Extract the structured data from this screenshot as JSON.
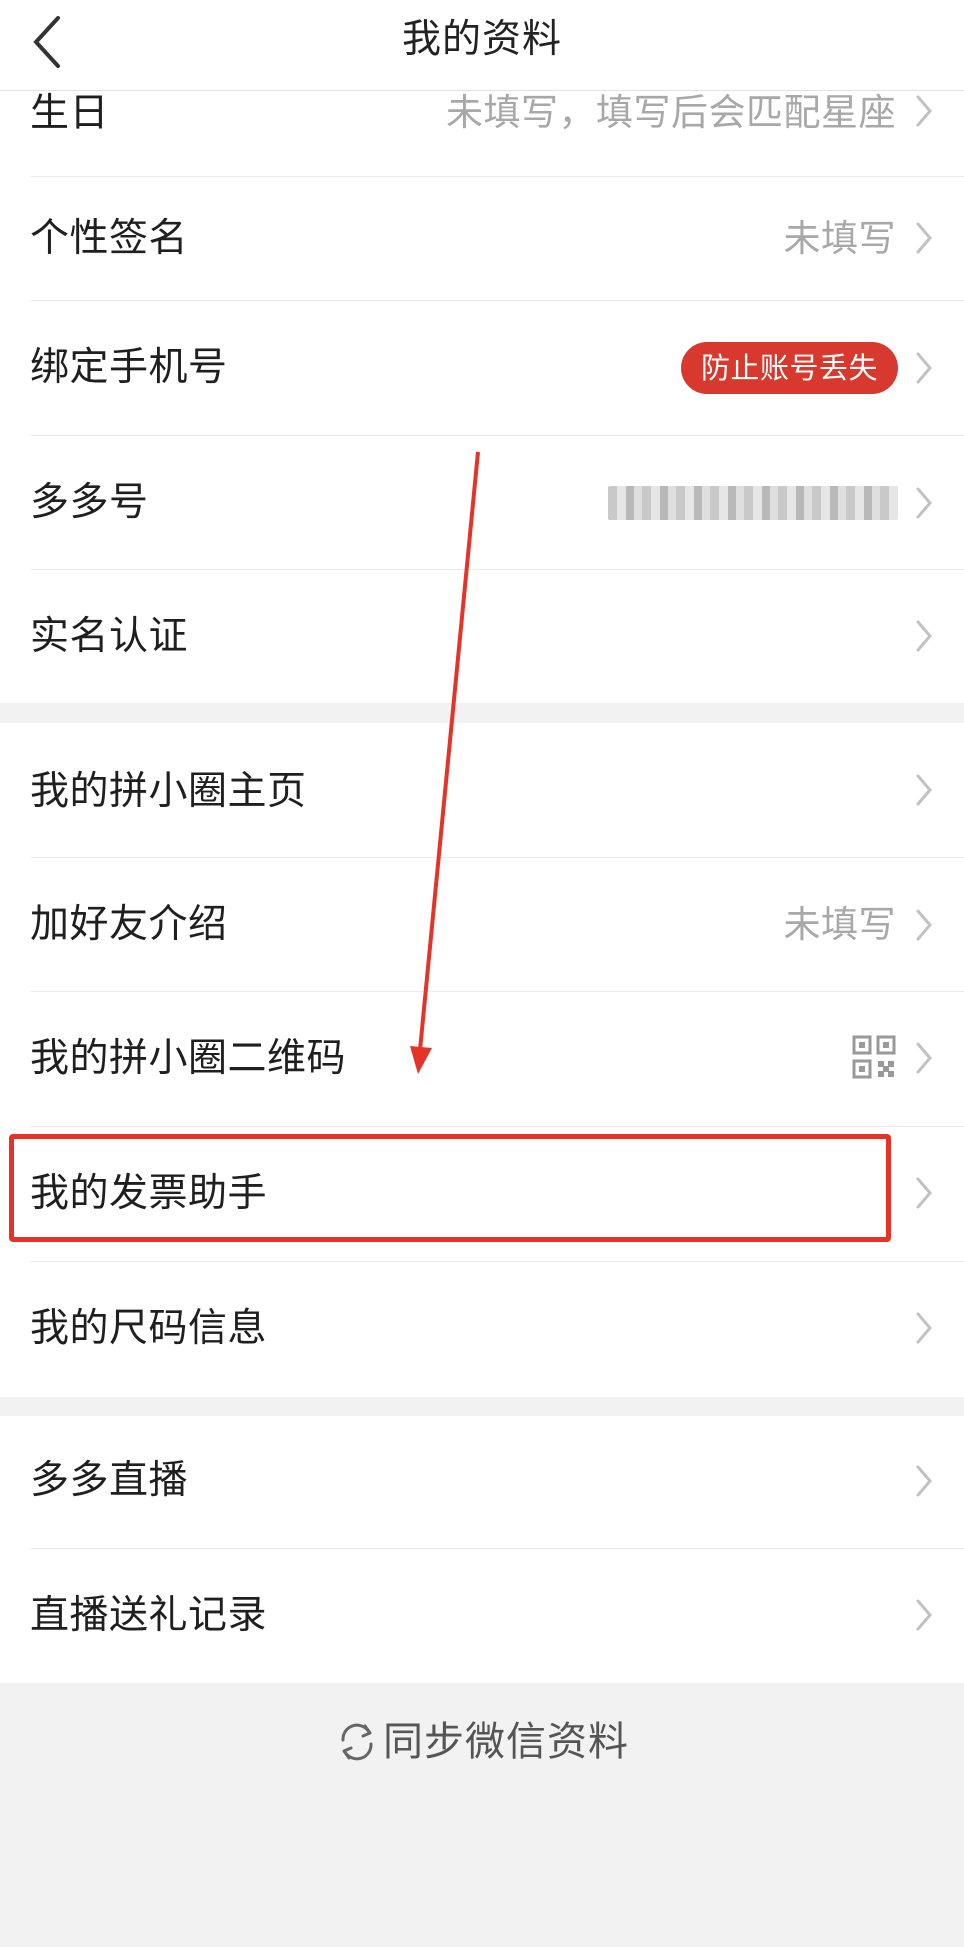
{
  "header": {
    "title": "我的资料"
  },
  "group1": {
    "rows": [
      {
        "label": "生日",
        "value": "未填写，填写后会匹配星座"
      },
      {
        "label": "个性签名",
        "value": "未填写"
      },
      {
        "label": "绑定手机号",
        "badge": "防止账号丢失"
      },
      {
        "label": "多多号",
        "value_obscured": true
      },
      {
        "label": "实名认证"
      }
    ]
  },
  "group2": {
    "rows": [
      {
        "label": "我的拼小圈主页"
      },
      {
        "label": "加好友介绍",
        "value": "未填写"
      },
      {
        "label": "我的拼小圈二维码",
        "icon": "qr-code-icon"
      },
      {
        "label": "我的发票助手",
        "highlighted": true
      },
      {
        "label": "我的尺码信息"
      }
    ]
  },
  "group3": {
    "rows": [
      {
        "label": "多多直播"
      },
      {
        "label": "直播送礼记录"
      }
    ]
  },
  "footer": {
    "sync_label": "同步微信资料",
    "sync_icon": "refresh-icon"
  },
  "colors": {
    "accent_red": "#d8392e",
    "annotation_red": "#e53327",
    "muted_text": "#a8a8a8",
    "background": "#f2f2f2"
  }
}
